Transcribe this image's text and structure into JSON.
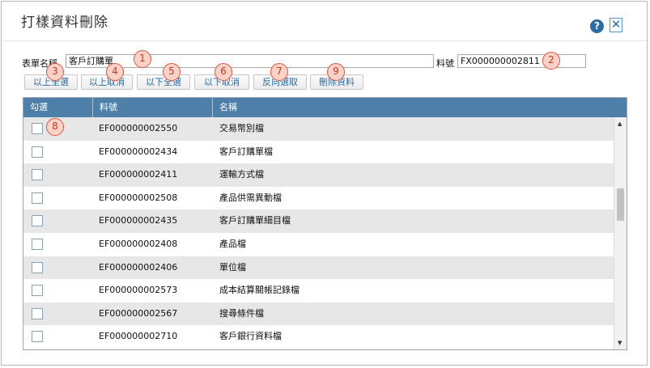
{
  "dialog": {
    "title": "打樣資料刪除",
    "help_glyph": "?",
    "close_glyph": "✕"
  },
  "form": {
    "table_name_label": "表單名稱",
    "table_name_value": "客戶訂購單",
    "part_no_label": "料號",
    "part_no_value": "FX000000002811"
  },
  "toolbar": {
    "select_above": "以上全選",
    "deselect_above": "以上取消",
    "select_below": "以下全選",
    "deselect_below": "以下取消",
    "invert_selection": "反向選取",
    "delete_data": "刪除資料"
  },
  "badges": [
    "1",
    "2",
    "3",
    "4",
    "5",
    "6",
    "7",
    "8",
    "9"
  ],
  "grid": {
    "columns": [
      "勾選",
      "料號",
      "名稱"
    ],
    "rows": [
      {
        "part_no": "EF000000002550",
        "name": "交易幣別檔",
        "checked": false
      },
      {
        "part_no": "EF000000002434",
        "name": "客戶訂購單檔",
        "checked": false
      },
      {
        "part_no": "EF000000002411",
        "name": "運輸方式檔",
        "checked": false
      },
      {
        "part_no": "EF000000002508",
        "name": "產品供需異動檔",
        "checked": false
      },
      {
        "part_no": "EF000000002435",
        "name": "客戶訂購單細目檔",
        "checked": false
      },
      {
        "part_no": "EF000000002408",
        "name": "產品檔",
        "checked": false
      },
      {
        "part_no": "EF000000002406",
        "name": "單位檔",
        "checked": false
      },
      {
        "part_no": "EF000000002573",
        "name": "成本結算關帳記錄檔",
        "checked": false
      },
      {
        "part_no": "EF000000002567",
        "name": "搜尋條件檔",
        "checked": false
      },
      {
        "part_no": "EF000000002710",
        "name": "客戶銀行資料檔",
        "checked": false
      }
    ]
  },
  "colors": {
    "header_bg": "#4d7fa9",
    "badge_border": "#e2543d",
    "accent": "#2e6da4"
  }
}
